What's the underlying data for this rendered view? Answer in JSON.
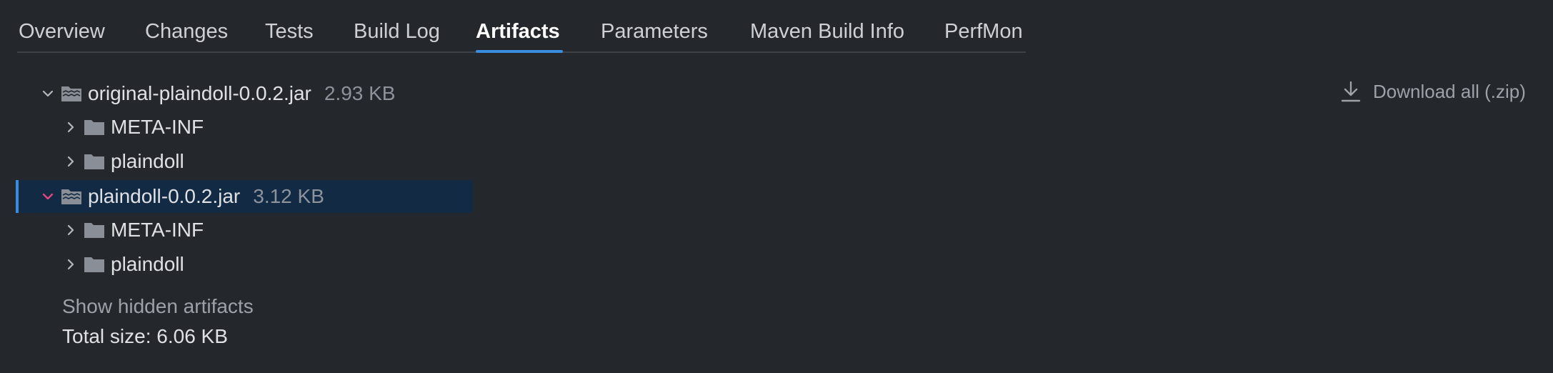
{
  "tabs": [
    {
      "label": "Overview"
    },
    {
      "label": "Changes"
    },
    {
      "label": "Tests"
    },
    {
      "label": "Build Log"
    },
    {
      "label": "Artifacts"
    },
    {
      "label": "Parameters"
    },
    {
      "label": "Maven Build Info"
    },
    {
      "label": "PerfMon"
    }
  ],
  "active_tab": "Artifacts",
  "download_all_label": "Download all (.zip)",
  "tree": {
    "artifact1": {
      "name": "original-plaindoll-0.0.2.jar",
      "size": "2.93 KB",
      "expanded": true
    },
    "artifact1_children": [
      {
        "name": "META-INF"
      },
      {
        "name": "plaindoll"
      }
    ],
    "artifact2": {
      "name": "plaindoll-0.0.2.jar",
      "size": "3.12 KB",
      "expanded": true,
      "selected": true
    },
    "artifact2_children": [
      {
        "name": "META-INF"
      },
      {
        "name": "plaindoll"
      }
    ]
  },
  "show_hidden_label": "Show hidden artifacts",
  "total_size_label": "Total size: 6.06 KB",
  "colors": {
    "background": "#24272c",
    "accent": "#3a8ddc",
    "selected_row": "#122a44",
    "selected_chevron": "#e0457b"
  }
}
